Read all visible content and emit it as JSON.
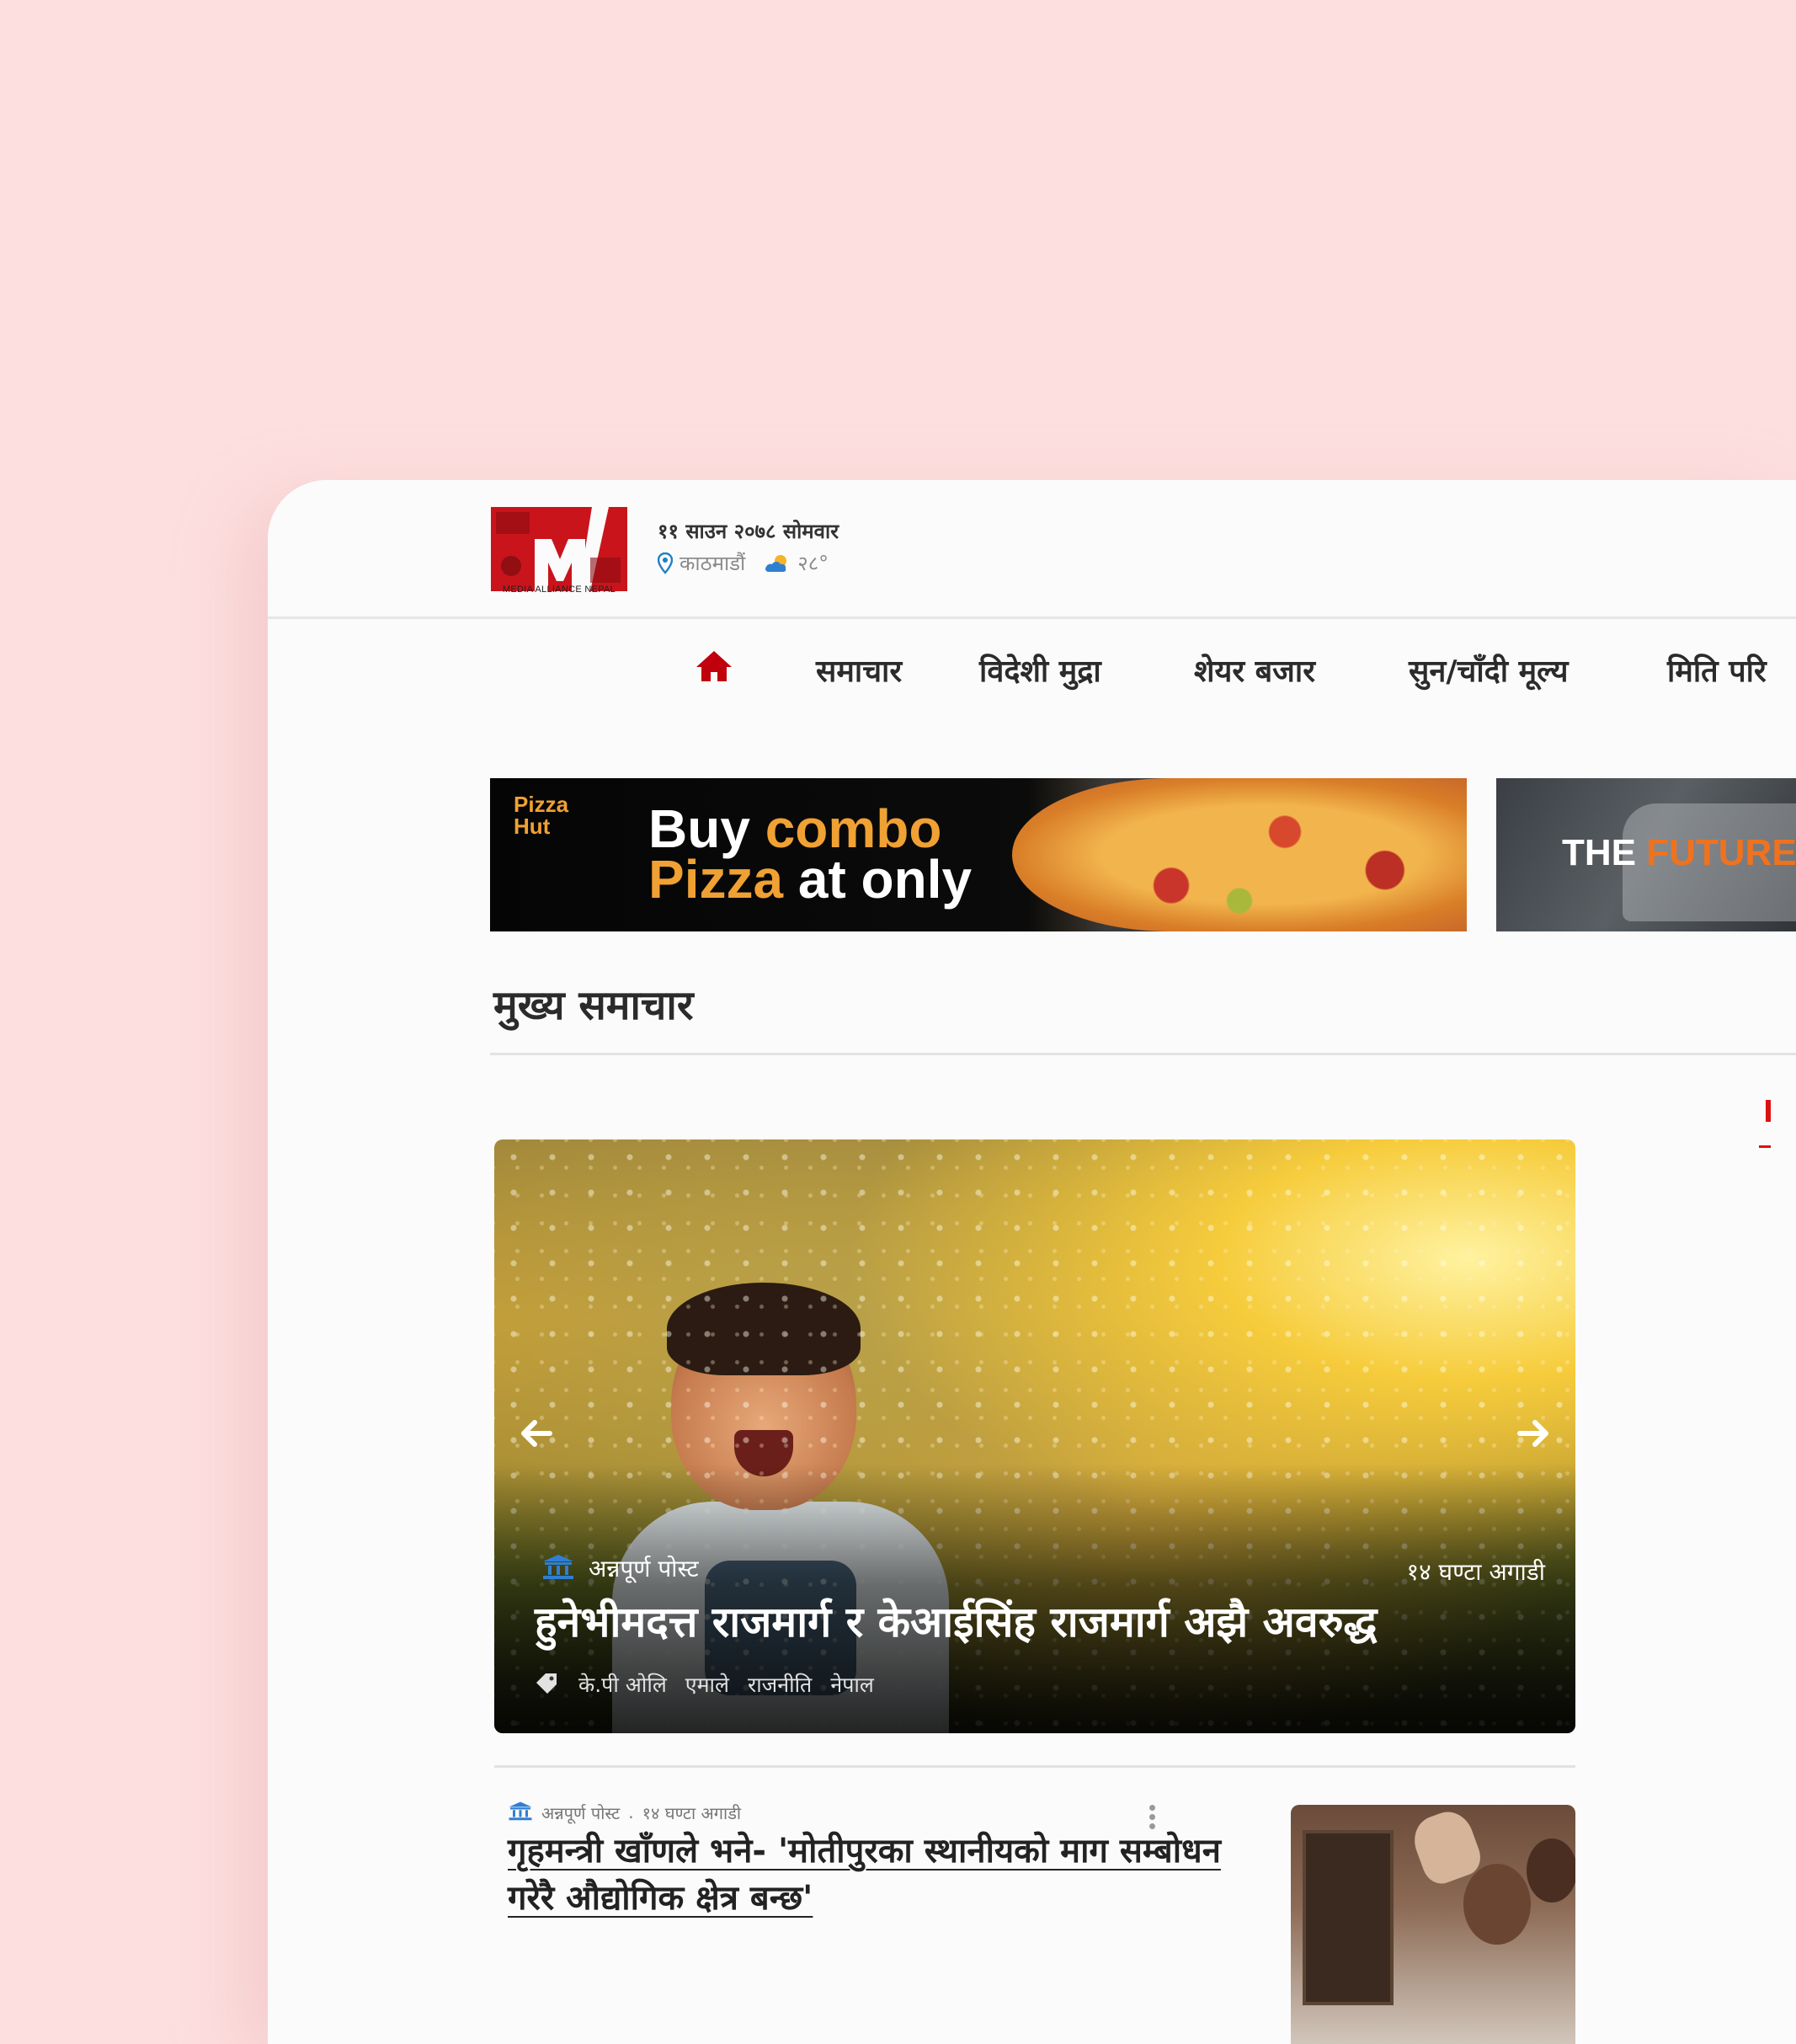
{
  "header": {
    "logo_caption": "MEDIA ALLIANCE NEPAL",
    "date": "११ साउन २०७८ सोमवार",
    "location": "काठमाडौं",
    "temperature": "२८°"
  },
  "nav": {
    "home_icon": "home-icon",
    "items": [
      "समाचार",
      "विदेशी मुद्रा",
      "शेयर बजार",
      "सुन/चाँदी मूल्य",
      "मिति परि"
    ]
  },
  "ads": {
    "ad1": {
      "brand_line1": "Pizza",
      "brand_line2": "Hut",
      "word1": "Buy",
      "word2": "combo",
      "word3": "Pizza",
      "word4": "at only"
    },
    "ad2": {
      "word1": "THE",
      "word2": "FUTURE"
    }
  },
  "section": {
    "title": "मुख्य समाचार"
  },
  "hero": {
    "source": "अन्नपूर्ण पोस्ट",
    "time": "१४ घण्टा अगाडी",
    "headline": "हुनेभीमदत्त राजमार्ग र केआईसिंह राजमार्ग अझै अवरुद्ध",
    "tags": [
      "के.पी ओलि",
      "एमाले",
      "राजनीति",
      "नेपाल"
    ]
  },
  "article": {
    "source": "अन्नपूर्ण पोस्ट",
    "separator": ".",
    "time": "१४ घण्टा अगाडी",
    "title": "गृहमन्त्री खाँणले भने- 'मोतीपुरका स्थानीयको माग सम्बोधन गरेरै औद्योगिक क्षेत्र बन्छ'"
  },
  "colors": {
    "accent": "#c0000c",
    "background": "#fddfdf",
    "ad_orange": "#f0a133",
    "ad_future_orange": "#f0721f"
  }
}
